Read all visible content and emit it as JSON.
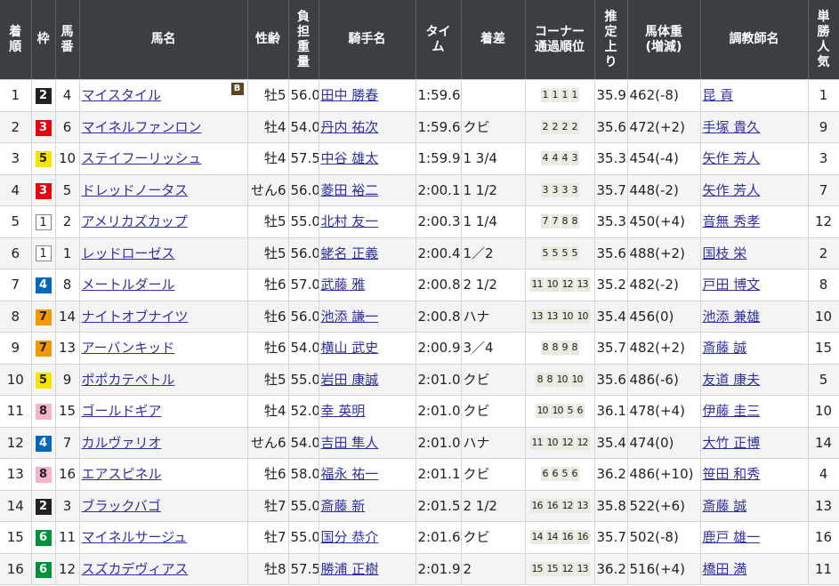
{
  "headers": [
    "着順",
    "枠",
    "馬番",
    "馬名",
    "性齢",
    "負担重量",
    "騎手名",
    "タイム",
    "着差",
    "コーナー通過順位",
    "推定上り",
    "馬体重(増減)",
    "調教師名",
    "単勝人気"
  ],
  "rows": [
    {
      "rank": "1",
      "waku": "2",
      "num": "4",
      "horse": "マイスタイル",
      "blinker": "B",
      "sexage": "牡5",
      "weight": "56.0",
      "jockey": "田中 勝春",
      "time": "1:59.6",
      "margin": "",
      "corners": [
        "1",
        "1",
        "1",
        "1"
      ],
      "last3f": "35.9",
      "body": "462(-8)",
      "trainer": "昆 貢",
      "pop": "1"
    },
    {
      "rank": "2",
      "waku": "3",
      "num": "6",
      "horse": "マイネルファンロン",
      "blinker": "",
      "sexage": "牡4",
      "weight": "54.0",
      "jockey": "丹内 祐次",
      "time": "1:59.6",
      "margin": "クビ",
      "corners": [
        "2",
        "2",
        "2",
        "2"
      ],
      "last3f": "35.6",
      "body": "472(+2)",
      "trainer": "手塚 貴久",
      "pop": "9"
    },
    {
      "rank": "3",
      "waku": "5",
      "num": "10",
      "horse": "ステイフーリッシュ",
      "blinker": "",
      "sexage": "牡4",
      "weight": "57.5",
      "jockey": "中谷 雄太",
      "time": "1:59.9",
      "margin": "1 3/4",
      "corners": [
        "4",
        "4",
        "4",
        "3"
      ],
      "last3f": "35.3",
      "body": "454(-4)",
      "trainer": "矢作 芳人",
      "pop": "3"
    },
    {
      "rank": "4",
      "waku": "3",
      "num": "5",
      "horse": "ドレッドノータス",
      "blinker": "",
      "sexage": "せん6",
      "weight": "56.0",
      "jockey": "菱田 裕二",
      "time": "2:00.1",
      "margin": "1 1/2",
      "corners": [
        "3",
        "3",
        "3",
        "3"
      ],
      "last3f": "35.7",
      "body": "448(-2)",
      "trainer": "矢作 芳人",
      "pop": "7"
    },
    {
      "rank": "5",
      "waku": "1",
      "num": "2",
      "horse": "アメリカズカップ",
      "blinker": "",
      "sexage": "牡5",
      "weight": "55.0",
      "jockey": "北村 友一",
      "time": "2:00.3",
      "margin": "1 1/4",
      "corners": [
        "7",
        "7",
        "8",
        "8"
      ],
      "last3f": "35.3",
      "body": "450(+4)",
      "trainer": "音無 秀孝",
      "pop": "12"
    },
    {
      "rank": "6",
      "waku": "1",
      "num": "1",
      "horse": "レッドローゼス",
      "blinker": "",
      "sexage": "牡5",
      "weight": "56.0",
      "jockey": "蛯名 正義",
      "time": "2:00.4",
      "margin": "1／2",
      "corners": [
        "5",
        "5",
        "5",
        "5"
      ],
      "last3f": "35.6",
      "body": "488(+2)",
      "trainer": "国枝 栄",
      "pop": "2"
    },
    {
      "rank": "7",
      "waku": "4",
      "num": "8",
      "horse": "メートルダール",
      "blinker": "",
      "sexage": "牡6",
      "weight": "57.0",
      "jockey": "武藤 雅",
      "time": "2:00.8",
      "margin": "2 1/2",
      "corners": [
        "11",
        "10",
        "12",
        "13"
      ],
      "last3f": "35.2",
      "body": "482(-2)",
      "trainer": "戸田 博文",
      "pop": "8"
    },
    {
      "rank": "8",
      "waku": "7",
      "num": "14",
      "horse": "ナイトオブナイツ",
      "blinker": "",
      "sexage": "牡6",
      "weight": "56.0",
      "jockey": "池添 謙一",
      "time": "2:00.8",
      "margin": "ハナ",
      "corners": [
        "13",
        "13",
        "10",
        "10"
      ],
      "last3f": "35.4",
      "body": "456(0)",
      "trainer": "池添 兼雄",
      "pop": "10"
    },
    {
      "rank": "9",
      "waku": "7",
      "num": "13",
      "horse": "アーバンキッド",
      "blinker": "",
      "sexage": "牡6",
      "weight": "54.0",
      "jockey": "横山 武史",
      "time": "2:00.9",
      "margin": "3／4",
      "corners": [
        "8",
        "8",
        "9",
        "8"
      ],
      "last3f": "35.7",
      "body": "482(+2)",
      "trainer": "斎藤 誠",
      "pop": "15"
    },
    {
      "rank": "10",
      "waku": "5",
      "num": "9",
      "horse": "ポポカテペトル",
      "blinker": "",
      "sexage": "牡5",
      "weight": "55.0",
      "jockey": "岩田 康誠",
      "time": "2:01.0",
      "margin": "クビ",
      "corners": [
        "8",
        "8",
        "10",
        "10"
      ],
      "last3f": "35.6",
      "body": "486(-6)",
      "trainer": "友道 康夫",
      "pop": "5"
    },
    {
      "rank": "11",
      "waku": "8",
      "num": "15",
      "horse": "ゴールドギア",
      "blinker": "",
      "sexage": "牡4",
      "weight": "52.0",
      "jockey": "幸 英明",
      "time": "2:01.0",
      "margin": "クビ",
      "corners": [
        "10",
        "10",
        "5",
        "6"
      ],
      "last3f": "36.1",
      "body": "478(+4)",
      "trainer": "伊藤 圭三",
      "pop": "10"
    },
    {
      "rank": "12",
      "waku": "4",
      "num": "7",
      "horse": "カルヴァリオ",
      "blinker": "",
      "sexage": "せん6",
      "weight": "54.0",
      "jockey": "吉田 隼人",
      "time": "2:01.0",
      "margin": "ハナ",
      "corners": [
        "11",
        "10",
        "12",
        "12"
      ],
      "last3f": "35.4",
      "body": "474(0)",
      "trainer": "大竹 正博",
      "pop": "14"
    },
    {
      "rank": "13",
      "waku": "8",
      "num": "16",
      "horse": "エアスピネル",
      "blinker": "",
      "sexage": "牡6",
      "weight": "58.0",
      "jockey": "福永 祐一",
      "time": "2:01.1",
      "margin": "クビ",
      "corners": [
        "6",
        "6",
        "5",
        "6"
      ],
      "last3f": "36.2",
      "body": "486(+10)",
      "trainer": "笹田 和秀",
      "pop": "4"
    },
    {
      "rank": "14",
      "waku": "2",
      "num": "3",
      "horse": "ブラックバゴ",
      "blinker": "",
      "sexage": "牡7",
      "weight": "55.0",
      "jockey": "斎藤 新",
      "time": "2:01.5",
      "margin": "2 1/2",
      "corners": [
        "16",
        "16",
        "12",
        "13"
      ],
      "last3f": "35.8",
      "body": "522(+6)",
      "trainer": "斎藤 誠",
      "pop": "13"
    },
    {
      "rank": "15",
      "waku": "6",
      "num": "11",
      "horse": "マイネルサージュ",
      "blinker": "",
      "sexage": "牡7",
      "weight": "55.0",
      "jockey": "国分 恭介",
      "time": "2:01.6",
      "margin": "クビ",
      "corners": [
        "14",
        "14",
        "16",
        "16"
      ],
      "last3f": "35.7",
      "body": "502(-8)",
      "trainer": "鹿戸 雄一",
      "pop": "16"
    },
    {
      "rank": "16",
      "waku": "6",
      "num": "12",
      "horse": "スズカデヴィアス",
      "blinker": "",
      "sexage": "牡8",
      "weight": "57.5",
      "jockey": "勝浦 正樹",
      "time": "2:01.9",
      "margin": "2",
      "corners": [
        "15",
        "15",
        "12",
        "13"
      ],
      "last3f": "36.2",
      "body": "516(+4)",
      "trainer": "橋田 満",
      "pop": "11"
    }
  ]
}
